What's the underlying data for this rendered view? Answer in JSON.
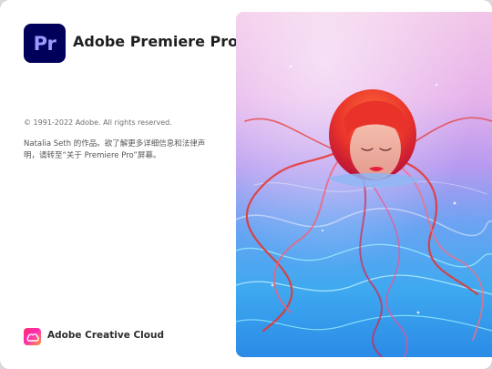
{
  "app": {
    "logo_text": "Pr",
    "title": "Adobe Premiere Pro"
  },
  "info": {
    "copyright": "© 1991-2022 Adobe. All rights reserved.",
    "credit": "Natalia Seth 的作品。欲了解更多详细信息和法律声明，请转至“关于 Premiere Pro”屏幕。"
  },
  "footer": {
    "label": "Adobe Creative Cloud"
  },
  "colors": {
    "app_logo_bg": "#00005b",
    "app_logo_fg": "#9999ff",
    "hair": "#e8322a"
  }
}
